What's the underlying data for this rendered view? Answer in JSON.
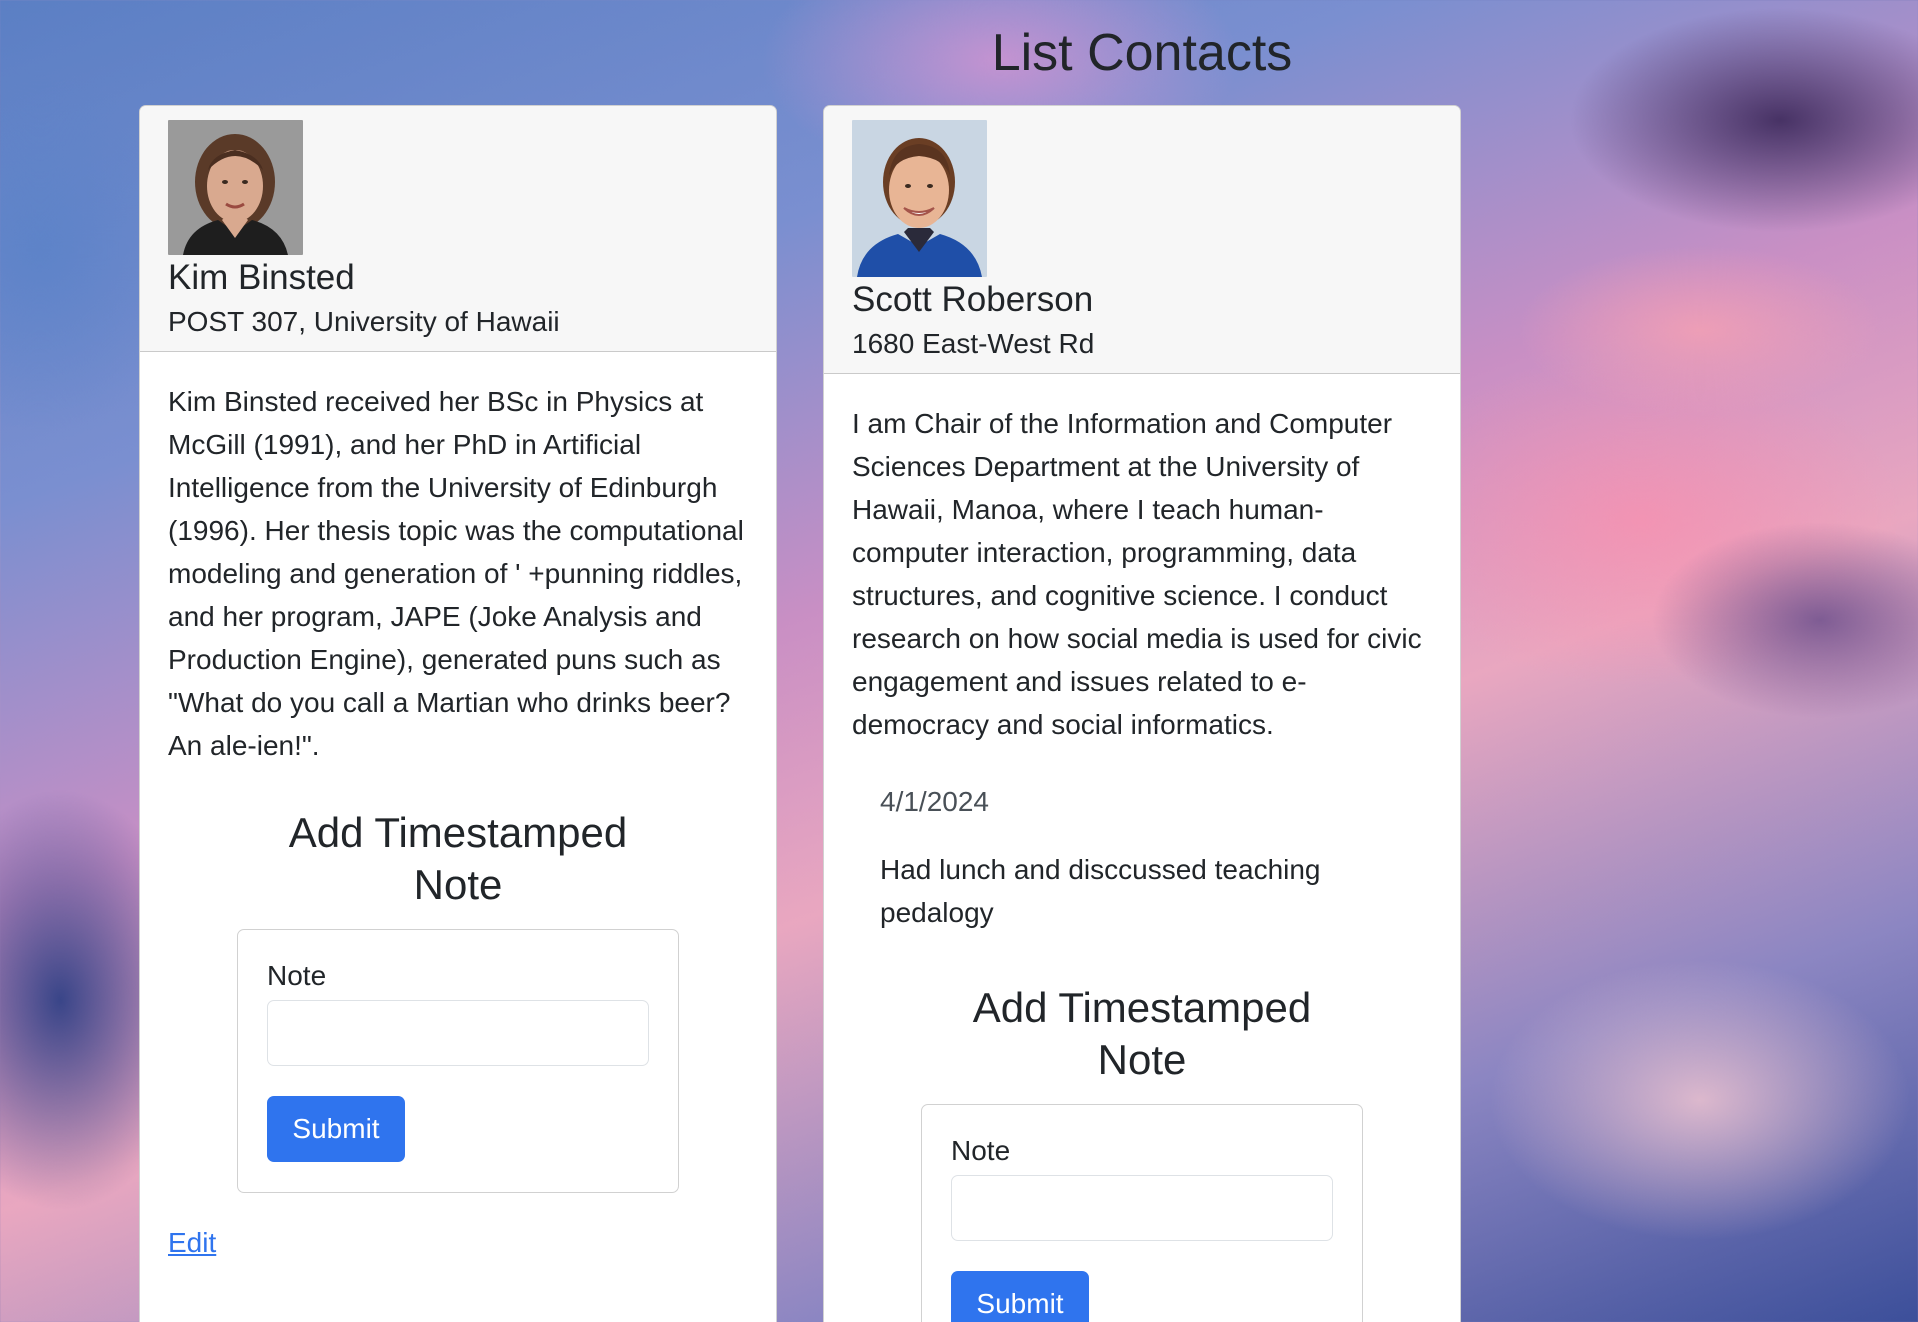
{
  "page": {
    "title": "List Contacts"
  },
  "contacts": [
    {
      "name": "Kim Binsted",
      "address": "POST 307, University of Hawaii",
      "description": "Kim Binsted received her BSc in Physics at McGill (1991), and her PhD in Artificial Intelligence from the University of Edinburgh (1996). Her thesis topic was the computational modeling and generation of ' +punning riddles, and her program, JAPE (Joke Analysis and Production Engine), generated puns such as \"What do you call a Martian who drinks beer? An ale-ien!\".",
      "notes": [],
      "form": {
        "title": "Add Timestamped Note",
        "note_label": "Note",
        "note_value": "",
        "submit_label": "Submit"
      },
      "edit_label": "Edit"
    },
    {
      "name": "Scott Roberson",
      "address": "1680 East-West Rd",
      "description": "I am Chair of the Information and Computer Sciences Department at the University of Hawaii, Manoa, where I teach human-computer interaction, programming, data structures, and cognitive science. I conduct research on how social media is used for civic engagement and issues related to e-democracy and social informatics.",
      "notes": [
        {
          "date": "4/1/2024",
          "text": "Had lunch and disccussed teaching pedalogy"
        }
      ],
      "form": {
        "title": "Add Timestamped Note",
        "note_label": "Note",
        "note_value": "",
        "submit_label": "Submit"
      }
    }
  ],
  "colors": {
    "primary": "#2f74ee",
    "text": "#212529",
    "card_header_bg": "#f7f7f7"
  }
}
